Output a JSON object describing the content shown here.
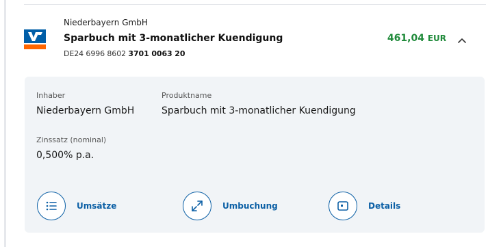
{
  "account": {
    "bank_name": "Niederbayern GmbH",
    "product_title": "Sparbuch mit 3-monatlicher Kuendigung",
    "iban_prefix": "DE24 6996 8602 ",
    "iban_suffix": "3701 0063 20",
    "balance_amount": "461,04",
    "balance_currency": "EUR",
    "balance_color": "#1f8a3a"
  },
  "details": {
    "owner_label": "Inhaber",
    "owner_value": "Niederbayern GmbH",
    "product_label": "Produktname",
    "product_value": "Sparbuch mit 3-monatlicher Kuendigung",
    "rate_label": "Zinssatz (nominal)",
    "rate_value": "0,500% p.a."
  },
  "actions": [
    {
      "label": "Umsätze",
      "icon": "list-icon"
    },
    {
      "label": "Umbuchung",
      "icon": "transfer-arrows-icon"
    },
    {
      "label": "Details",
      "icon": "card-icon"
    }
  ],
  "colors": {
    "accent": "#0b5fa5",
    "logo_blue": "#005ea8",
    "logo_orange": "#ff6600",
    "panel_bg": "#f1f4f7"
  }
}
